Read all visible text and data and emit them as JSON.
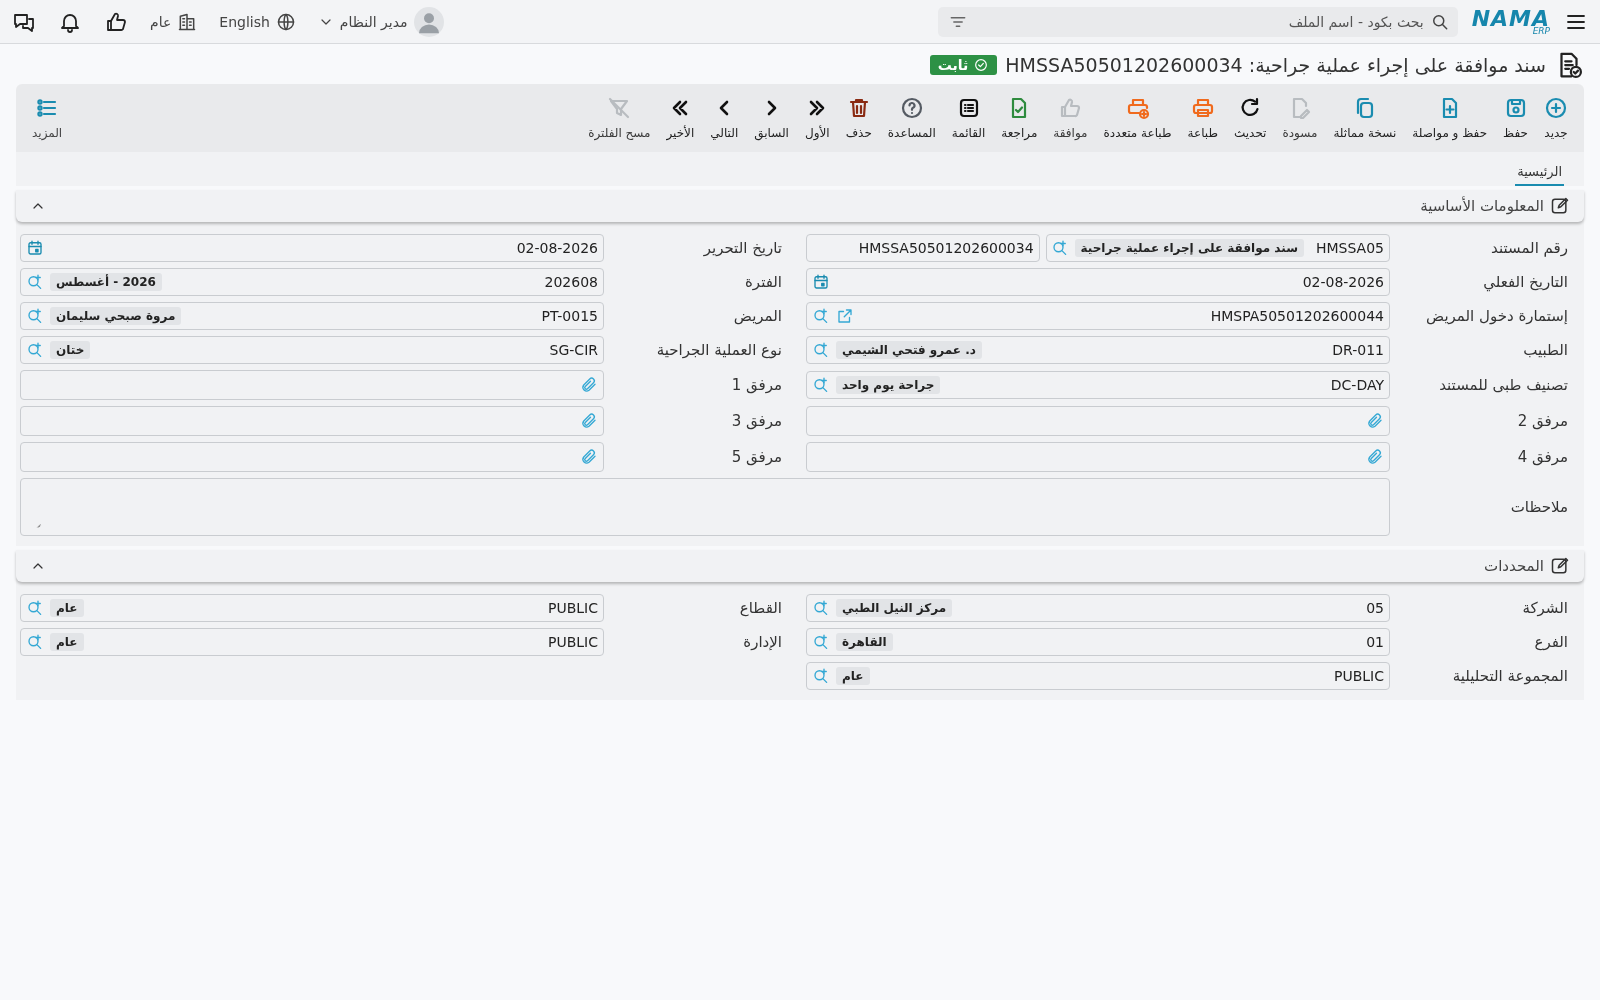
{
  "topbar": {
    "logo": "NAMA",
    "logo_sub": "ERP",
    "search": {
      "placeholder": "بحث بكود - اسم الملف"
    },
    "user": "مدير النظام",
    "language": "English",
    "company": "عام"
  },
  "title": {
    "text": "سند موافقة على إجراء عملية جراحية: HMSSA50501202600034",
    "status": "ثابت"
  },
  "toolbar": [
    {
      "kind": "new",
      "label": "جديد",
      "disabled": false,
      "color": "#1a8cb0"
    },
    {
      "kind": "save",
      "label": "حفظ",
      "disabled": false,
      "color": "#1a8cb0"
    },
    {
      "kind": "save_continue",
      "label": "حفظ و مواصلة",
      "disabled": false,
      "color": "#1a8cb0"
    },
    {
      "kind": "copy",
      "label": "نسخة مماثلة",
      "disabled": false,
      "color": "#1a8cb0"
    },
    {
      "kind": "draft",
      "label": "مسودة",
      "disabled": true,
      "color": "#b8bcc0"
    },
    {
      "kind": "refresh",
      "label": "تحديث",
      "disabled": false,
      "color": "#111111"
    },
    {
      "kind": "print",
      "label": "طباعة",
      "disabled": false,
      "color": "#f06a1d"
    },
    {
      "kind": "multi_print",
      "label": "طباعة متعددة",
      "disabled": false,
      "color": "#f06a1d"
    },
    {
      "kind": "approve",
      "label": "موافقة",
      "disabled": true,
      "color": "#b8bcc0"
    },
    {
      "kind": "review",
      "label": "مراجعة",
      "disabled": false,
      "color": "#2e8b3e"
    },
    {
      "kind": "list",
      "label": "القائمة",
      "disabled": false,
      "color": "#111111"
    },
    {
      "kind": "help",
      "label": "المساعدة",
      "disabled": false,
      "color": "#555b63"
    },
    {
      "kind": "delete",
      "label": "حذف",
      "disabled": false,
      "color": "#8a2a12"
    },
    {
      "kind": "first",
      "label": "الأول",
      "disabled": false,
      "color": "#111111"
    },
    {
      "kind": "previous",
      "label": "السابق",
      "disabled": false,
      "color": "#111111"
    },
    {
      "kind": "next",
      "label": "التالي",
      "disabled": false,
      "color": "#111111"
    },
    {
      "kind": "last",
      "label": "الأخير",
      "disabled": false,
      "color": "#111111"
    },
    {
      "kind": "clear_filter",
      "label": "مسح الفلترة",
      "disabled": true,
      "color": "#b8bcc0"
    }
  ],
  "more": {
    "label": "المزيد"
  },
  "tabs": [
    {
      "label": "الرئيسية",
      "selected": true
    }
  ],
  "sections": [
    {
      "title": "المعلومات الأساسية",
      "expanded": true,
      "fields": [
        {
          "kind": "doc_number",
          "label": "رقم المستند",
          "value": "HMSSA05",
          "name": "سند موافقة على إجراء عملية جراحية",
          "number": "HMSSA50501202600034"
        },
        {
          "kind": "date",
          "label": "تاريخ التحرير",
          "value": "02-08-2026"
        },
        {
          "kind": "date",
          "label": "التاريخ الفعلي",
          "value": "02-08-2026"
        },
        {
          "kind": "lookup",
          "label": "الفترة",
          "value": "202608",
          "name": "2026 - أغسطس"
        },
        {
          "kind": "link_lookup",
          "label": "إستمارة دخول المريض",
          "value": "HMSPA50501202600044"
        },
        {
          "kind": "lookup",
          "label": "المريض",
          "value": "PT-0015",
          "name": "مروة صبحي سليمان"
        },
        {
          "kind": "lookup",
          "label": "الطبيب",
          "value": "DR-011",
          "name": "د. عمرو فتحي الشيمي"
        },
        {
          "kind": "lookup",
          "label": "نوع العملية الجراحية",
          "value": "SG-CIR",
          "name": "ختان"
        },
        {
          "kind": "lookup",
          "label": "تصنيف طبى للمستند",
          "value": "DC-DAY",
          "name": "جراحة يوم واحد"
        },
        {
          "kind": "attachment",
          "label": "مرفق 1"
        },
        {
          "kind": "attachment",
          "label": "مرفق 2"
        },
        {
          "kind": "attachment",
          "label": "مرفق 3"
        },
        {
          "kind": "attachment",
          "label": "مرفق 4"
        },
        {
          "kind": "attachment",
          "label": "مرفق 5"
        },
        {
          "kind": "notes",
          "label": "ملاحظات"
        }
      ]
    },
    {
      "title": "المحددات",
      "expanded": true,
      "fields": [
        {
          "kind": "lookup",
          "label": "الشركة",
          "value": "05",
          "name": "مركز النيل الطبي"
        },
        {
          "kind": "lookup",
          "label": "القطاع",
          "value": "PUBLIC",
          "name": "عام"
        },
        {
          "kind": "lookup",
          "label": "الفرع",
          "value": "01",
          "name": "القاهرة"
        },
        {
          "kind": "lookup",
          "label": "الإدارة",
          "value": "PUBLIC",
          "name": "عام"
        },
        {
          "kind": "lookup",
          "label": "المجموعة التحليلية",
          "value": "PUBLIC",
          "name": "عام"
        }
      ]
    }
  ]
}
